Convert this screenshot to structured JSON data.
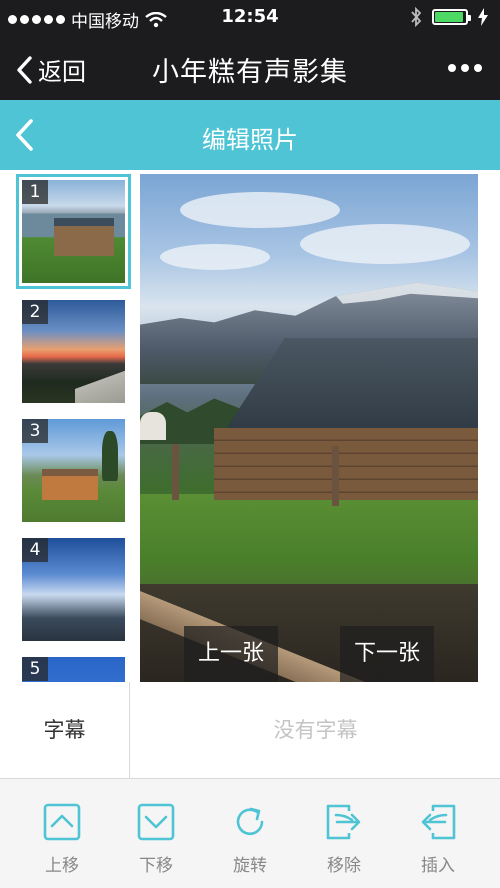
{
  "status_bar": {
    "carrier": "中国移动",
    "time": "12:54"
  },
  "nav": {
    "back_label": "返回",
    "title": "小年糕有声影集"
  },
  "header": {
    "title": "编辑照片"
  },
  "thumbnails": [
    {
      "number": "1",
      "selected": true
    },
    {
      "number": "2",
      "selected": false
    },
    {
      "number": "3",
      "selected": false
    },
    {
      "number": "4",
      "selected": false
    },
    {
      "number": "5",
      "selected": false
    }
  ],
  "photo": {
    "prev_label": "上一张",
    "next_label": "下一张"
  },
  "caption": {
    "label": "字幕",
    "placeholder": "没有字幕"
  },
  "toolbar": {
    "items": [
      {
        "label": "上移",
        "icon": "move-up-icon"
      },
      {
        "label": "下移",
        "icon": "move-down-icon"
      },
      {
        "label": "旋转",
        "icon": "rotate-icon"
      },
      {
        "label": "移除",
        "icon": "remove-icon"
      },
      {
        "label": "插入",
        "icon": "insert-icon"
      }
    ]
  },
  "colors": {
    "accent": "#4ec4d4",
    "bar": "#1c1c1e",
    "battery": "#4cd964"
  }
}
